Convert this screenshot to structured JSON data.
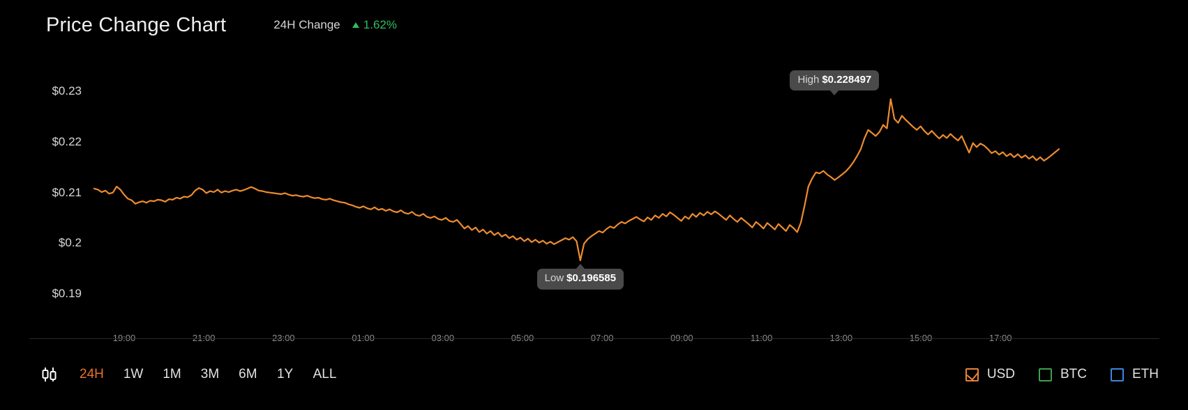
{
  "header": {
    "title": "Price Change Chart",
    "change_label": "24H Change",
    "change_value": "1.62%",
    "change_direction_icon": "triangle-up-icon",
    "change_color": "#2fbf5e"
  },
  "tooltips": {
    "high": {
      "label": "High",
      "value": "$0.228497"
    },
    "low": {
      "label": "Low",
      "value": "$0.196585"
    }
  },
  "toolbar": {
    "candlestick_icon": "candlestick-chart-icon",
    "ranges": [
      {
        "label": "24H",
        "active": true
      },
      {
        "label": "1W",
        "active": false
      },
      {
        "label": "1M",
        "active": false
      },
      {
        "label": "3M",
        "active": false
      },
      {
        "label": "6M",
        "active": false
      },
      {
        "label": "1Y",
        "active": false
      },
      {
        "label": "ALL",
        "active": false
      }
    ],
    "active_color": "#e8722a",
    "currencies": [
      {
        "label": "USD",
        "checked": true,
        "color": "#e8833a"
      },
      {
        "label": "BTC",
        "checked": false,
        "color": "#3fa14a"
      },
      {
        "label": "ETH",
        "checked": false,
        "color": "#3d86e0"
      }
    ]
  },
  "chart_data": {
    "type": "line",
    "title": "Price Change Chart",
    "xlabel": "",
    "ylabel": "",
    "line_color": "#ee8c2e",
    "background": "#000000",
    "grid": false,
    "legend": null,
    "ylim": [
      0.19,
      0.2335
    ],
    "ytick_labels": [
      "$0.23",
      "$0.22",
      "$0.21",
      "$0.2",
      "$0.19"
    ],
    "ytick_values": [
      0.23,
      0.22,
      0.21,
      0.2,
      0.19
    ],
    "xtick_labels": [
      "19:00",
      "21:00",
      "23:00",
      "01:00",
      "03:00",
      "05:00",
      "07:00",
      "09:00",
      "11:00",
      "13:00",
      "15:00",
      "17:00"
    ],
    "annotations": [
      {
        "name": "high",
        "text": "High $0.228497",
        "value": 0.228497,
        "x_index": 198
      },
      {
        "name": "low",
        "text": "Low $0.196585",
        "value": 0.196585,
        "x_index": 130
      }
    ],
    "x_start_time": "18:20",
    "x_end_time": "17:50",
    "series": [
      {
        "name": "Price (USD)",
        "values": [
          0.2108,
          0.2106,
          0.2101,
          0.2104,
          0.2098,
          0.21,
          0.2112,
          0.2106,
          0.2096,
          0.2088,
          0.2085,
          0.2078,
          0.2081,
          0.2083,
          0.208,
          0.2084,
          0.2083,
          0.2086,
          0.2085,
          0.2082,
          0.2087,
          0.2086,
          0.209,
          0.2088,
          0.2092,
          0.2091,
          0.2095,
          0.2104,
          0.2109,
          0.2106,
          0.2099,
          0.2103,
          0.2101,
          0.2106,
          0.21,
          0.2103,
          0.2101,
          0.2104,
          0.2106,
          0.2103,
          0.2105,
          0.2108,
          0.2111,
          0.2108,
          0.2104,
          0.2103,
          0.2101,
          0.21,
          0.2099,
          0.2098,
          0.2097,
          0.2099,
          0.2096,
          0.2094,
          0.2095,
          0.2093,
          0.2092,
          0.2094,
          0.2091,
          0.2089,
          0.209,
          0.2087,
          0.2086,
          0.2088,
          0.2085,
          0.2083,
          0.2081,
          0.208,
          0.2077,
          0.2075,
          0.2072,
          0.207,
          0.2073,
          0.2069,
          0.2067,
          0.2071,
          0.2066,
          0.2068,
          0.2064,
          0.2067,
          0.2063,
          0.2061,
          0.2065,
          0.206,
          0.2058,
          0.2062,
          0.2056,
          0.2054,
          0.2058,
          0.2052,
          0.205,
          0.2053,
          0.2048,
          0.2046,
          0.205,
          0.2044,
          0.2042,
          0.2046,
          0.2038,
          0.2029,
          0.2034,
          0.2026,
          0.2031,
          0.2022,
          0.2027,
          0.2019,
          0.2024,
          0.2016,
          0.2021,
          0.2013,
          0.2017,
          0.201,
          0.2014,
          0.2007,
          0.2011,
          0.2004,
          0.2009,
          0.2002,
          0.2007,
          0.2001,
          0.2005,
          0.1999,
          0.2003,
          0.1998,
          0.2002,
          0.2006,
          0.201,
          0.2007,
          0.2012,
          0.2004,
          0.1966,
          0.1999,
          0.2008,
          0.2014,
          0.2019,
          0.2024,
          0.2021,
          0.2028,
          0.2033,
          0.203,
          0.2037,
          0.2042,
          0.2039,
          0.2044,
          0.2048,
          0.2052,
          0.2047,
          0.2043,
          0.2051,
          0.2046,
          0.2055,
          0.205,
          0.2058,
          0.2053,
          0.2061,
          0.2056,
          0.205,
          0.2044,
          0.2053,
          0.2048,
          0.2058,
          0.2052,
          0.206,
          0.2055,
          0.2062,
          0.2057,
          0.2063,
          0.2058,
          0.2052,
          0.2046,
          0.2055,
          0.2048,
          0.2042,
          0.205,
          0.2044,
          0.2038,
          0.2031,
          0.2042,
          0.2036,
          0.2029,
          0.204,
          0.2034,
          0.2027,
          0.2038,
          0.2031,
          0.2024,
          0.2036,
          0.203,
          0.2022,
          0.2041,
          0.2075,
          0.2112,
          0.2128,
          0.214,
          0.2138,
          0.2143,
          0.2136,
          0.2131,
          0.2125,
          0.213,
          0.2136,
          0.2142,
          0.215,
          0.216,
          0.2172,
          0.2186,
          0.2208,
          0.2224,
          0.2218,
          0.2212,
          0.222,
          0.2234,
          0.2227,
          0.2285,
          0.2246,
          0.2238,
          0.2252,
          0.2244,
          0.2237,
          0.223,
          0.2224,
          0.2231,
          0.2222,
          0.2215,
          0.2222,
          0.2214,
          0.2207,
          0.2214,
          0.2208,
          0.2216,
          0.2209,
          0.2203,
          0.2212,
          0.2195,
          0.2179,
          0.2198,
          0.219,
          0.2197,
          0.2193,
          0.2186,
          0.2178,
          0.2182,
          0.2175,
          0.218,
          0.2172,
          0.2177,
          0.217,
          0.2176,
          0.2169,
          0.2174,
          0.2167,
          0.2172,
          0.2164,
          0.217,
          0.2163,
          0.2168,
          0.2174,
          0.218,
          0.2186
        ]
      }
    ]
  }
}
